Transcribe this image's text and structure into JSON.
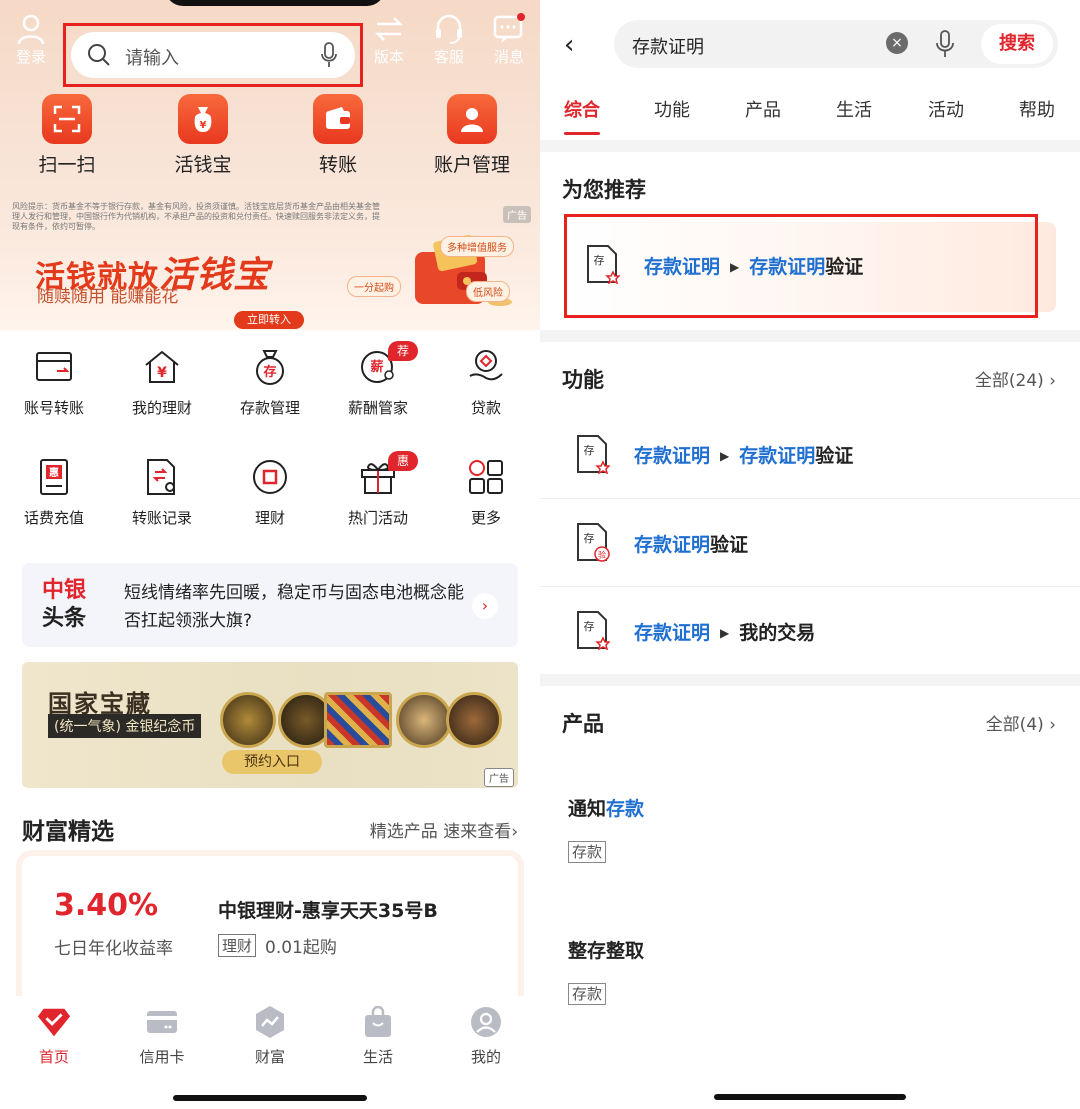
{
  "left": {
    "topbar": {
      "login": "登录",
      "search_placeholder": "请输入",
      "version": "版本",
      "service": "客服",
      "message": "消息"
    },
    "quick_actions": [
      "扫一扫",
      "活钱宝",
      "转账",
      "账户管理"
    ],
    "banner": {
      "risk_notice": "风险提示：货币基金不等于银行存款，基金有风险，投资须谨慎。活钱宝底层货币基金产品由相关基金管理人发行和管理，中国银行作为代销机构，不承担产品的投资和兑付责任。快速赎回服务非法定义务，提现有条件，依约可暂停。",
      "ad_label": "广告",
      "title_a": "活钱就放",
      "title_b": "活钱宝",
      "subtitle": "随赎随用 能赚能花",
      "button": "立即转入",
      "pill1": "多种增值服务",
      "pill2": "一分起购",
      "pill3": "低风险"
    },
    "grid": [
      {
        "label": "账号转账",
        "badge": ""
      },
      {
        "label": "我的理财",
        "badge": ""
      },
      {
        "label": "存款管理",
        "badge": ""
      },
      {
        "label": "薪酬管家",
        "badge": "荐"
      },
      {
        "label": "贷款",
        "badge": ""
      },
      {
        "label": "话费充值",
        "badge": ""
      },
      {
        "label": "转账记录",
        "badge": ""
      },
      {
        "label": "理财",
        "badge": ""
      },
      {
        "label": "热门活动",
        "badge": "惠"
      },
      {
        "label": "更多",
        "badge": ""
      }
    ],
    "grid_icon_chars": {
      "deposit": "存",
      "salary": "薪",
      "hui": "惠",
      "yen": "¥"
    },
    "news": {
      "logo_line1": "中银",
      "logo_line2": "头条",
      "text": "短线情绪率先回暖，稳定币与固态电池概念能否扛起领涨大旗?",
      "arrow": "›"
    },
    "treasure": {
      "title": "国家宝藏",
      "subtitle": "(统一气象) 金银纪念币",
      "button": "预约入口",
      "ad_label": "广告"
    },
    "wealth": {
      "title": "财富精选",
      "more": "精选产品 速来查看›",
      "rate": "3.40%",
      "rate_label": "七日年化收益率",
      "product_name": "中银理财-惠享天天35号B",
      "product_tag": "理财",
      "min_purchase": "0.01起购"
    },
    "tabbar": [
      "首页",
      "信用卡",
      "财富",
      "生活",
      "我的"
    ]
  },
  "right": {
    "back": "‹",
    "search_value": "存款证明",
    "clear": "×",
    "search_button": "搜索",
    "tabs": [
      "综合",
      "功能",
      "产品",
      "生活",
      "活动",
      "帮助"
    ],
    "recommend": {
      "title": "为您推荐",
      "item": {
        "a": "存款证明",
        "b_hl": "存款证明",
        "b_rest": "验证"
      }
    },
    "functions": {
      "title": "功能",
      "all": "全部(24)",
      "items": [
        {
          "a": "存款证明",
          "b_hl": "存款证明",
          "b_rest": "验证",
          "icon": "存"
        },
        {
          "hl": "存款证明",
          "rest": "验证",
          "icon": "存"
        },
        {
          "a": "存款证明",
          "b": "我的交易",
          "icon": "存"
        }
      ]
    },
    "products": {
      "title": "产品",
      "all": "全部(4)",
      "items": [
        {
          "name_a": "通知",
          "name_hl": "存款",
          "tag": "存款"
        },
        {
          "name_a": "整存整取",
          "name_hl": "",
          "tag": "存款"
        }
      ]
    },
    "icon_badge_chars": {
      "verify": "验"
    }
  },
  "colors": {
    "brand_red": "#e0262c",
    "highlight_blue": "#1f6fd1",
    "annotation_red": "#e8211f"
  }
}
